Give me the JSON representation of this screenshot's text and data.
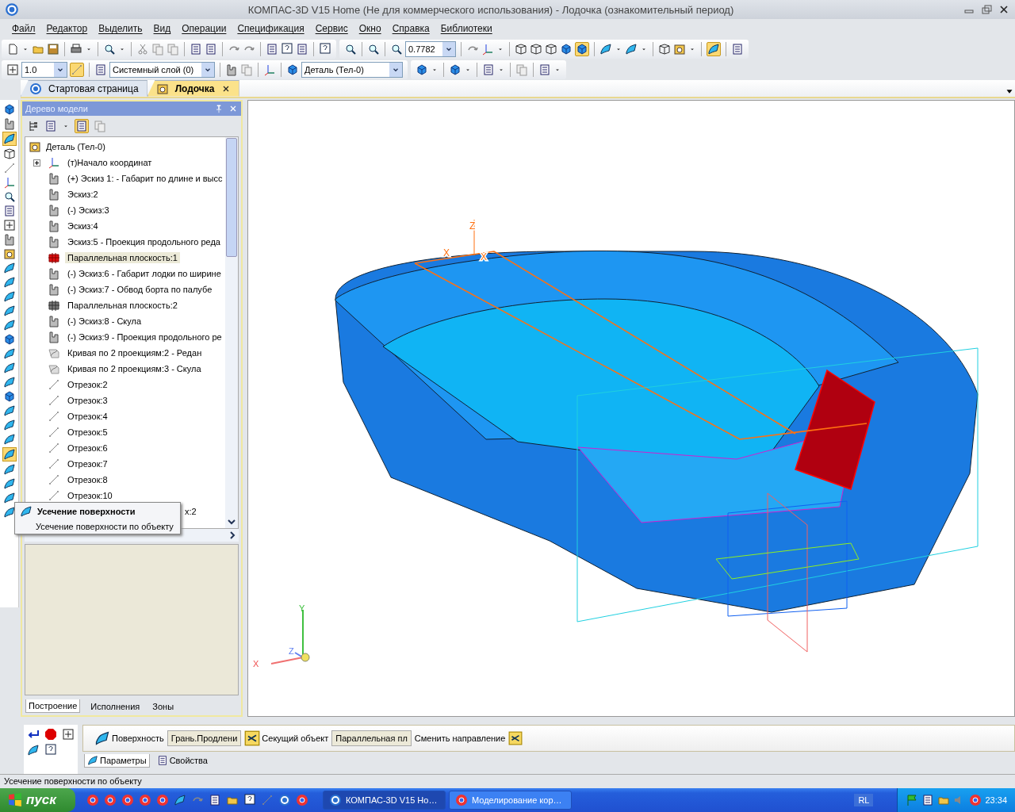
{
  "window": {
    "title": "КОМПАС-3D V15 Home (Не для коммерческого использования) - Лодочка (ознакомительный период)"
  },
  "menu": [
    {
      "label": "Файл"
    },
    {
      "label": "Редактор"
    },
    {
      "label": "Выделить"
    },
    {
      "label": "Вид"
    },
    {
      "label": "Операции"
    },
    {
      "label": "Спецификация"
    },
    {
      "label": "Сервис"
    },
    {
      "label": "Окно"
    },
    {
      "label": "Справка"
    },
    {
      "label": "Библиотеки"
    }
  ],
  "toolbar": {
    "zoom": "0.7782",
    "step": "1.0",
    "layer": "Системный слой (0)",
    "body": "Деталь (Тел-0)"
  },
  "doc_tabs": [
    {
      "label": "Стартовая страница",
      "selected": false
    },
    {
      "label": "Лодочка",
      "selected": true
    }
  ],
  "tree_panel": {
    "title": "Дерево модели",
    "root": {
      "label": "Деталь (Тел-0)",
      "children": [
        {
          "label": "(т)Начало координат",
          "kind": "origin",
          "expanded": false,
          "selected": false
        },
        {
          "label": "(+) Эскиз 1: - Габарит по длине и высс",
          "kind": "sketch",
          "selected": false
        },
        {
          "label": "Эскиз:2",
          "kind": "sketch",
          "selected": false
        },
        {
          "label": "(-) Эскиз:3",
          "kind": "sketch",
          "selected": false
        },
        {
          "label": "Эскиз:4",
          "kind": "sketch",
          "selected": false
        },
        {
          "label": "Эскиз:5 - Проекция продольного реда",
          "kind": "sketch",
          "selected": false
        },
        {
          "label": "Параллельная плоскость:1",
          "kind": "plane-active",
          "selected": true
        },
        {
          "label": "(-) Эскиз:6 - Габарит лодки по ширине",
          "kind": "sketch",
          "selected": false
        },
        {
          "label": "(-) Эскиз:7 - Обвод борта по палубе",
          "kind": "sketch",
          "selected": false
        },
        {
          "label": "Параллельная плоскость:2",
          "kind": "plane",
          "selected": false
        },
        {
          "label": "(-) Эскиз:8 - Скула",
          "kind": "sketch",
          "selected": false
        },
        {
          "label": "(-) Эскиз:9 - Проекция продольного ре",
          "kind": "sketch",
          "selected": false
        },
        {
          "label": "Кривая по 2 проекциям:2 - Редан",
          "kind": "curve",
          "selected": false
        },
        {
          "label": "Кривая по 2 проекциям:3 - Скула",
          "kind": "curve",
          "selected": false
        },
        {
          "label": "Отрезок:2",
          "kind": "segment",
          "selected": false
        },
        {
          "label": "Отрезок:3",
          "kind": "segment",
          "selected": false
        },
        {
          "label": "Отрезок:4",
          "kind": "segment",
          "selected": false
        },
        {
          "label": "Отрезок:5",
          "kind": "segment",
          "selected": false
        },
        {
          "label": "Отрезок:6",
          "kind": "segment",
          "selected": false
        },
        {
          "label": "Отрезок:7",
          "kind": "segment",
          "selected": false
        },
        {
          "label": "Отрезок:8",
          "kind": "segment",
          "selected": false
        },
        {
          "label": "Отрезок:10",
          "kind": "segment",
          "selected": false
        },
        {
          "label": "х:2",
          "kind": "covered",
          "selected": false
        }
      ]
    },
    "tabs": [
      {
        "label": "Построение",
        "selected": true
      },
      {
        "label": "Исполнения",
        "selected": false
      },
      {
        "label": "Зоны",
        "selected": false
      }
    ]
  },
  "tooltip": {
    "title": "Усечение поверхности",
    "text": "Усечение поверхности по объекту"
  },
  "viewport": {
    "sketch_labels": [
      "Z",
      "X",
      "X"
    ],
    "triad_labels": [
      "Y",
      "X",
      "Z"
    ]
  },
  "property_panel": {
    "fields": [
      {
        "button": "Поверхность",
        "value": "Грань.Продлени"
      },
      {
        "button": "Секущий объект",
        "value": "Параллельная пл"
      }
    ],
    "action": "Сменить направление",
    "tabs": [
      {
        "label": "Параметры",
        "selected": true
      },
      {
        "label": "Свойства",
        "selected": false
      }
    ]
  },
  "status_bar": {
    "text": "Усечение поверхности по объекту"
  },
  "taskbar": {
    "start": "пуск",
    "tasks": [
      {
        "label": "КОМПАС-3D V15 Ho…",
        "selected": true
      },
      {
        "label": "Моделирование кор…",
        "selected": false
      }
    ],
    "language": "RL",
    "clock": "23:34"
  }
}
